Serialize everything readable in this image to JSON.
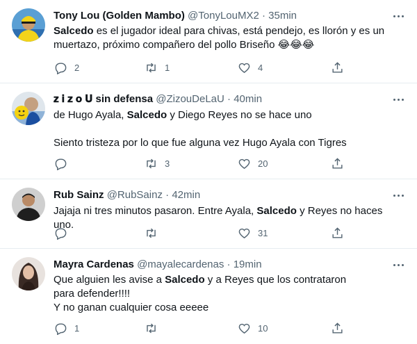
{
  "tweets": [
    {
      "name": "Tony Lou (Golden Mambo)",
      "handle": "@TonyLouMX2",
      "dot": "·",
      "time": "35min",
      "text_bold": "Salcedo",
      "text_1": " es el jugador ideal para chivas, está pendejo, es llorón y es un muertazo, próximo compañero del pollo Briseño 😂😂😂",
      "replies": "2",
      "retweets": "1",
      "likes": "4"
    },
    {
      "name": "𝐳 𝐢 𝐳 𝐨 𝐔 sin defensa",
      "handle": "@ZizouDeLaU",
      "dot": "·",
      "time": "40min",
      "text_a_pre": "de Hugo Ayala, ",
      "text_bold": "Salcedo",
      "text_a_post": " y Diego Reyes no se hace uno",
      "text_b": "Siento tristeza por lo que fue alguna vez Hugo Ayala con Tigres",
      "replies": "",
      "retweets": "3",
      "likes": "20"
    },
    {
      "name": "Rub Sainz",
      "handle": "@RubSainz",
      "dot": "·",
      "time": "42min",
      "text_pre": "Jajaja ni tres minutos pasaron. Entre Ayala, ",
      "text_bold": "Salcedo",
      "text_post": " y Reyes no haces uno.",
      "replies": "",
      "retweets": "",
      "likes": "31"
    },
    {
      "name": "Mayra Cardenas",
      "handle": "@mayalecardenas",
      "dot": "·",
      "time": "19min",
      "text_pre": "Que alguien les avise a ",
      "text_bold": "Salcedo",
      "text_post": " y a Reyes que los contrataron para defender!!!!",
      "text_b": "Y no ganan cualquier cosa eeeee",
      "replies": "1",
      "retweets": "",
      "likes": "10"
    }
  ],
  "icons": {
    "reply": "reply-icon",
    "retweet": "retweet-icon",
    "like": "heart-icon",
    "share": "share-icon",
    "more": "more-icon"
  }
}
